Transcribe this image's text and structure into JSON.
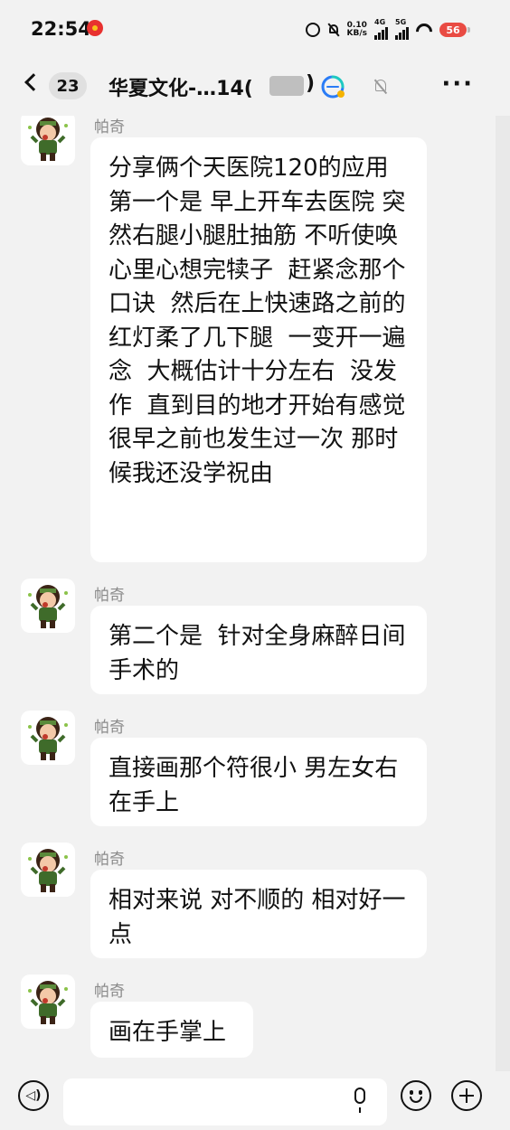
{
  "status_bar": {
    "time": "22:54",
    "net_speed_value": "0.10",
    "net_speed_unit": "KB/s",
    "signal1_label": "4G",
    "signal2_label": "5G",
    "battery": "56",
    "icons": [
      "weibo-icon",
      "alarm-icon",
      "mute-icon",
      "signal-icon",
      "wifi-icon",
      "battery-icon"
    ]
  },
  "nav": {
    "unread_count": "23",
    "title": "华夏文化-…14(",
    "title_tail": ")"
  },
  "messages": [
    {
      "sender": "帕奇",
      "text": "分享俩个天医院120的应用\n第一个是 早上开车去医院 突然右腿小腿肚抽筋 不听使唤  心里心想完犊子  赶紧念那个口诀  然后在上快速路之前的红灯柔了几下腿  一变开一遍念  大概估计十分左右  没发作  直到目的地才开始有感觉  很早之前也发生过一次 那时候我还没学祝由"
    },
    {
      "sender": "帕奇",
      "text": "第二个是  针对全身麻醉日间手术的"
    },
    {
      "sender": "帕奇",
      "text": "直接画那个符很小 男左女右在手上"
    },
    {
      "sender": "帕奇",
      "text": "相对来说 对不顺的 相对好一点"
    },
    {
      "sender": "帕奇",
      "text": "画在手掌上"
    }
  ],
  "input": {
    "value": "",
    "placeholder": ""
  },
  "colors": {
    "background": "#f2f2f2",
    "bubble": "#ffffff",
    "sender_name": "#8a8a8a",
    "battery": "#e94b43"
  }
}
